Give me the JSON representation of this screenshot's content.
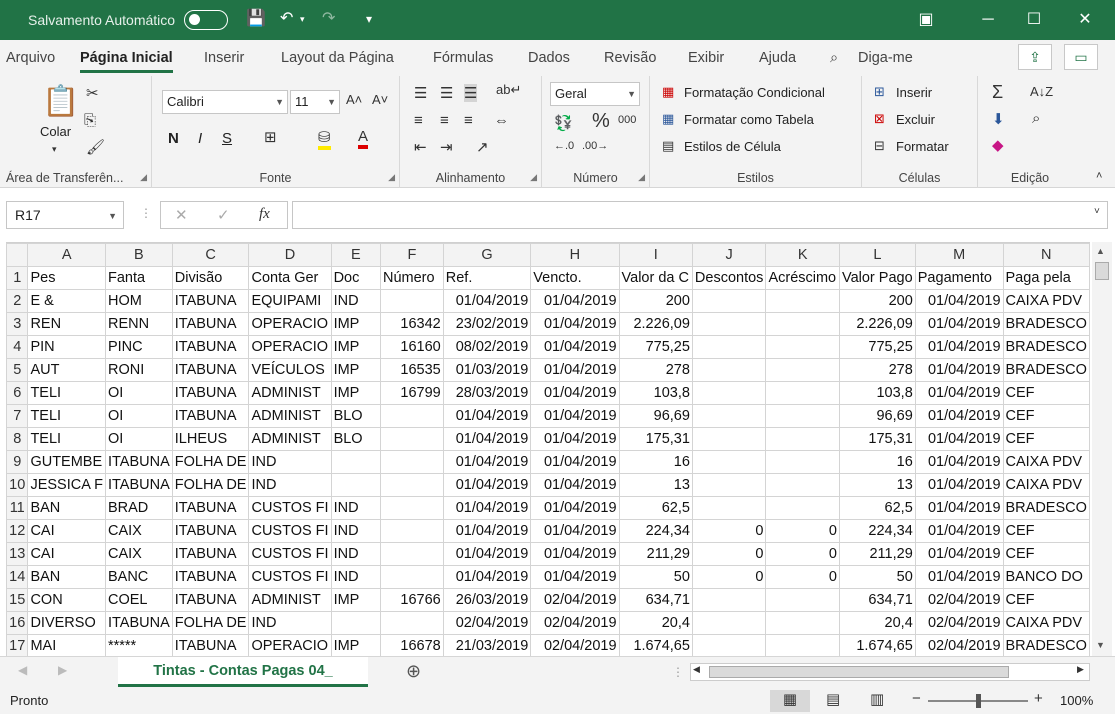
{
  "titlebar": {
    "autosave_label": "Salvamento Automático",
    "bg_color": "#217346"
  },
  "menu": {
    "tabs": [
      "Arquivo",
      "Página Inicial",
      "Inserir",
      "Layout da Página",
      "Fórmulas",
      "Dados",
      "Revisão",
      "Exibir",
      "Ajuda"
    ],
    "active": "Página Inicial",
    "tellme": "Diga-me"
  },
  "ribbon": {
    "clipboard": {
      "label": "Área de Transferên...",
      "paste": "Colar"
    },
    "font": {
      "label": "Fonte",
      "name": "Calibri",
      "size": "11",
      "bold": "N",
      "italic": "I",
      "underline": "S"
    },
    "alignment": {
      "label": "Alinhamento"
    },
    "number": {
      "label": "Número",
      "format": "Geral"
    },
    "styles": {
      "label": "Estilos",
      "conditional": "Formatação Condicional",
      "as_table": "Formatar como Tabela",
      "cell_styles": "Estilos de Célula"
    },
    "cells": {
      "label": "Células",
      "insert": "Inserir",
      "delete": "Excluir",
      "format": "Formatar"
    },
    "editing": {
      "label": "Edição"
    }
  },
  "formula": {
    "namebox": "R17",
    "fx": "fx",
    "content": ""
  },
  "sheet": {
    "col_letters": [
      "A",
      "B",
      "C",
      "D",
      "E",
      "F",
      "G",
      "H",
      "I",
      "J",
      "K",
      "L",
      "M",
      "N"
    ],
    "rows": [
      [
        "1",
        "Pes",
        "Fanta",
        "Divisão",
        "Conta Ger",
        "Doc",
        "Número",
        "Ref.",
        "Vencto.",
        "Valor da C",
        "Descontos",
        "Acréscimo",
        "Valor Pago",
        "Pagamento",
        "Paga pela"
      ],
      [
        "2",
        "E &",
        "HOM",
        "ITABUNA",
        "EQUIPAMI",
        "IND",
        "",
        "01/04/2019",
        "01/04/2019",
        "200",
        "",
        "",
        "200",
        "01/04/2019",
        "CAIXA PDV"
      ],
      [
        "3",
        "REN",
        "RENN",
        "ITABUNA",
        "OPERACIO",
        "IMP",
        "16342",
        "23/02/2019",
        "01/04/2019",
        "2.226,09",
        "",
        "",
        "2.226,09",
        "01/04/2019",
        "BRADESCO"
      ],
      [
        "4",
        "PIN",
        "PINC",
        "ITABUNA",
        "OPERACIO",
        "IMP",
        "16160",
        "08/02/2019",
        "01/04/2019",
        "775,25",
        "",
        "",
        "775,25",
        "01/04/2019",
        "BRADESCO"
      ],
      [
        "5",
        "AUT",
        "RONI",
        "ITABUNA",
        "VEÍCULOS",
        "IMP",
        "16535",
        "01/03/2019",
        "01/04/2019",
        "278",
        "",
        "",
        "278",
        "01/04/2019",
        "BRADESCO"
      ],
      [
        "6",
        "TELI",
        "OI",
        "ITABUNA",
        "ADMINIST",
        "IMP",
        "16799",
        "28/03/2019",
        "01/04/2019",
        "103,8",
        "",
        "",
        "103,8",
        "01/04/2019",
        "CEF"
      ],
      [
        "7",
        "TELI",
        "OI",
        "ITABUNA",
        "ADMINIST",
        "BLO",
        "",
        "01/04/2019",
        "01/04/2019",
        "96,69",
        "",
        "",
        "96,69",
        "01/04/2019",
        "CEF"
      ],
      [
        "8",
        "TELI",
        "OI",
        "ILHEUS",
        "ADMINIST",
        "BLO",
        "",
        "01/04/2019",
        "01/04/2019",
        "175,31",
        "",
        "",
        "175,31",
        "01/04/2019",
        "CEF"
      ],
      [
        "9",
        "GUTEMBE",
        "ITABUNA",
        "FOLHA DE",
        "IND",
        "",
        "",
        "01/04/2019",
        "01/04/2019",
        "16",
        "",
        "",
        "16",
        "01/04/2019",
        "CAIXA PDV"
      ],
      [
        "10",
        "JESSICA F",
        "ITABUNA",
        "FOLHA DE",
        "IND",
        "",
        "",
        "01/04/2019",
        "01/04/2019",
        "13",
        "",
        "",
        "13",
        "01/04/2019",
        "CAIXA PDV"
      ],
      [
        "11",
        "BAN",
        "BRAD",
        "ITABUNA",
        "CUSTOS FI",
        "IND",
        "",
        "01/04/2019",
        "01/04/2019",
        "62,5",
        "",
        "",
        "62,5",
        "01/04/2019",
        "BRADESCO"
      ],
      [
        "12",
        "CAI",
        "CAIX",
        "ITABUNA",
        "CUSTOS FI",
        "IND",
        "",
        "01/04/2019",
        "01/04/2019",
        "224,34",
        "0",
        "0",
        "224,34",
        "01/04/2019",
        "CEF"
      ],
      [
        "13",
        "CAI",
        "CAIX",
        "ITABUNA",
        "CUSTOS FI",
        "IND",
        "",
        "01/04/2019",
        "01/04/2019",
        "211,29",
        "0",
        "0",
        "211,29",
        "01/04/2019",
        "CEF"
      ],
      [
        "14",
        "BAN",
        "BANC",
        "ITABUNA",
        "CUSTOS FI",
        "IND",
        "",
        "01/04/2019",
        "01/04/2019",
        "50",
        "0",
        "0",
        "50",
        "01/04/2019",
        "BANCO DO"
      ],
      [
        "15",
        "CON",
        "COEL",
        "ITABUNA",
        "ADMINIST",
        "IMP",
        "16766",
        "26/03/2019",
        "02/04/2019",
        "634,71",
        "",
        "",
        "634,71",
        "02/04/2019",
        "CEF"
      ],
      [
        "16",
        "DIVERSO",
        "ITABUNA",
        "FOLHA DE",
        "IND",
        "",
        "",
        "02/04/2019",
        "02/04/2019",
        "20,4",
        "",
        "",
        "20,4",
        "02/04/2019",
        "CAIXA PDV"
      ],
      [
        "17",
        "MAI",
        "*****",
        "ITABUNA",
        "OPERACIO",
        "IMP",
        "16678",
        "21/03/2019",
        "02/04/2019",
        "1.674,65",
        "",
        "",
        "1.674,65",
        "02/04/2019",
        "BRADESCO"
      ]
    ],
    "tab_name": "Tintas - Contas Pagas 04_"
  },
  "status": {
    "ready": "Pronto",
    "zoom": "100%",
    "zoom_fraction": 0.5
  }
}
